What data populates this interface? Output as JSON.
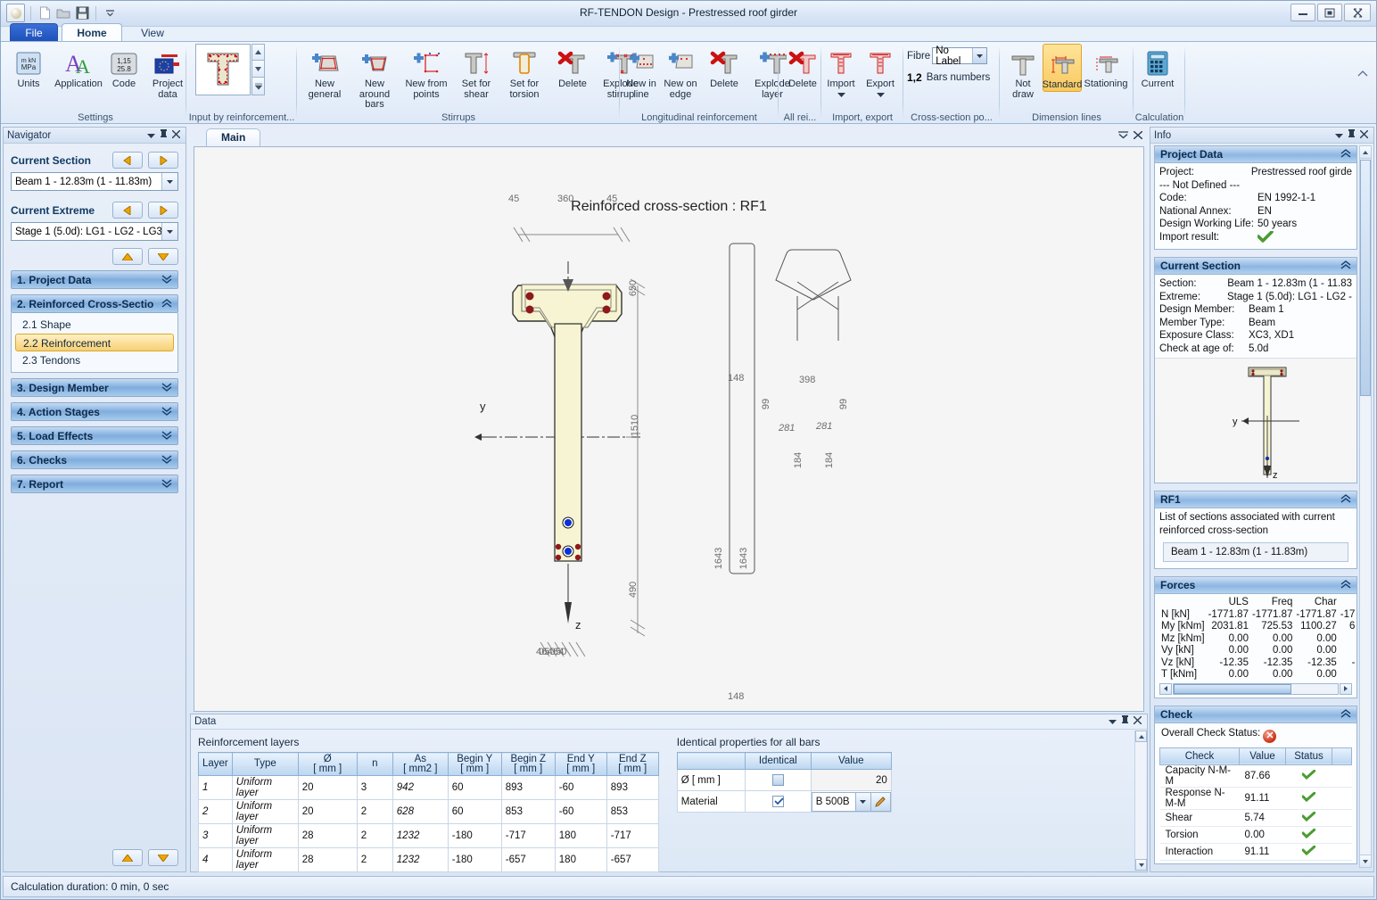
{
  "window": {
    "title": "RF-TENDON Design - Prestressed roof girder",
    "minimize": "–",
    "maximize": "□",
    "close": "✕"
  },
  "tabs": {
    "file": "File",
    "home": "Home",
    "view": "View"
  },
  "ribbon": {
    "groups": [
      {
        "title": "Settings",
        "buttons": [
          {
            "label": "Units",
            "icon": "units-icon"
          },
          {
            "label": "Application",
            "icon": "application-icon"
          },
          {
            "label": "Code",
            "icon": "code-icon"
          },
          {
            "label": "Project\ndata",
            "icon": "project-data-icon"
          }
        ]
      },
      {
        "title": "Input by reinforcement...",
        "gallery": "cross-section-gallery"
      },
      {
        "title": "Stirrups",
        "buttons": [
          {
            "label": "New\ngeneral",
            "icon": "new-general-icon"
          },
          {
            "label": "New around\nbars",
            "icon": "new-around-bars-icon"
          },
          {
            "label": "New from\npoints",
            "icon": "new-from-points-icon"
          },
          {
            "label": "Set for\nshear",
            "icon": "set-for-shear-icon"
          },
          {
            "label": "Set for\ntorsion",
            "icon": "set-for-torsion-icon"
          },
          {
            "label": "Delete",
            "icon": "delete-stirrup-icon"
          },
          {
            "label": "Explode\nstirrup",
            "icon": "explode-stirrup-icon"
          }
        ]
      },
      {
        "title": "Longitudinal reinforcement",
        "buttons": [
          {
            "label": "New in\nline",
            "icon": "new-in-line-icon"
          },
          {
            "label": "New on\nedge",
            "icon": "new-on-edge-icon"
          },
          {
            "label": "Delete",
            "icon": "delete-longitudinal-icon"
          },
          {
            "label": "Explode\nlayer",
            "icon": "explode-layer-icon"
          }
        ]
      },
      {
        "title": "All rei...",
        "buttons": [
          {
            "label": "Delete",
            "icon": "delete-all-icon"
          }
        ]
      },
      {
        "title": "Import, export",
        "buttons": [
          {
            "label": "Import",
            "icon": "import-icon",
            "dropdown": true
          },
          {
            "label": "Export",
            "icon": "export-icon",
            "dropdown": true
          }
        ]
      },
      {
        "title": "Cross-section po...",
        "fibre_label": "Fibre",
        "fibre_value": "No Label",
        "bars_numbers_prefix": "1,2",
        "bars_numbers_label": "Bars numbers"
      },
      {
        "title": "Dimension lines",
        "buttons": [
          {
            "label": "Not\ndraw",
            "icon": "not-draw-icon"
          },
          {
            "label": "Standard",
            "icon": "standard-dim-icon",
            "selected": true
          },
          {
            "label": "Stationing",
            "icon": "stationing-icon"
          }
        ]
      },
      {
        "title": "Calculation",
        "buttons": [
          {
            "label": "Current",
            "icon": "calculator-icon"
          }
        ]
      }
    ]
  },
  "navigator": {
    "panel_title": "Navigator",
    "current_section_label": "Current Section",
    "current_section_value": "Beam 1 - 12.83m (1 - 11.83m)",
    "current_extreme_label": "Current Extreme",
    "current_extreme_value": "Stage 1 (5.0d): LG1 - LG2 - LG3",
    "sections": [
      {
        "label": "1. Project Data",
        "expanded": false
      },
      {
        "label": "2. Reinforced Cross-Sectio",
        "expanded": true,
        "items": [
          {
            "label": "2.1 Shape",
            "active": false
          },
          {
            "label": "2.2 Reinforcement",
            "active": true
          },
          {
            "label": "2.3 Tendons",
            "active": false
          }
        ]
      },
      {
        "label": "3. Design Member",
        "expanded": false
      },
      {
        "label": "4. Action Stages",
        "expanded": false
      },
      {
        "label": "5. Load Effects",
        "expanded": false
      },
      {
        "label": "6. Checks",
        "expanded": false
      },
      {
        "label": "7. Report",
        "expanded": false
      }
    ]
  },
  "main": {
    "tab": "Main",
    "drawing_title": "Reinforced cross-section : RF1",
    "axis_y": "y",
    "axis_z": "z",
    "dimensions": {
      "top_left": "45",
      "top_mid": "360",
      "top_right": "45",
      "flange_height": "650",
      "web_height": "1510",
      "bottom_height": "490",
      "bottom_chain": "40 65 40 65 40"
    },
    "stirrup1": {
      "top": "148",
      "mid": "1643",
      "mid2": "1643",
      "bottom": "148"
    },
    "stirrup2": {
      "top": "398",
      "left_leg": "99",
      "right_leg": "99",
      "diag_left": "281",
      "diag_right": "281",
      "leg_left": "184",
      "leg_right": "184"
    }
  },
  "data_panel": {
    "panel_title": "Data",
    "table_label": "Reinforcement layers",
    "columns": [
      {
        "name": "Layer",
        "unit": ""
      },
      {
        "name": "Type",
        "unit": ""
      },
      {
        "name": "Ø",
        "unit": "[ mm ]"
      },
      {
        "name": "n",
        "unit": ""
      },
      {
        "name": "As",
        "unit": "[ mm2 ]"
      },
      {
        "name": "Begin Y",
        "unit": "[ mm ]"
      },
      {
        "name": "Begin Z",
        "unit": "[ mm ]"
      },
      {
        "name": "End Y",
        "unit": "[ mm ]"
      },
      {
        "name": "End Z",
        "unit": "[ mm ]"
      }
    ],
    "rows": [
      [
        "1",
        "Uniform layer",
        "20",
        "3",
        "942",
        "60",
        "893",
        "-60",
        "893"
      ],
      [
        "2",
        "Uniform layer",
        "20",
        "2",
        "628",
        "60",
        "853",
        "-60",
        "853"
      ],
      [
        "3",
        "Uniform layer",
        "28",
        "2",
        "1232",
        "-180",
        "-717",
        "180",
        "-717"
      ],
      [
        "4",
        "Uniform layer",
        "28",
        "2",
        "1232",
        "-180",
        "-657",
        "180",
        "-657"
      ]
    ],
    "identical_label": "Identical properties for all bars",
    "identical_columns": [
      "",
      "Identical",
      "Value"
    ],
    "identical_rows": [
      {
        "name": "Ø  [  mm  ]",
        "checked": false,
        "value": "20",
        "editor": "number"
      },
      {
        "name": "Material",
        "checked": true,
        "value": "B 500B",
        "editor": "combo"
      }
    ]
  },
  "info": {
    "panel_title": "Info",
    "project_data": {
      "title": "Project Data",
      "rows": [
        {
          "k": "Project:",
          "v": "Prestressed roof girde"
        },
        {
          "k": "--- Not Defined ---",
          "v": ""
        },
        {
          "k": "Code:",
          "v": "EN 1992-1-1"
        },
        {
          "k": "National Annex:",
          "v": "EN"
        },
        {
          "k": "Design Working Life:",
          "v": "50 years"
        },
        {
          "k": "Import result:",
          "v": ""
        }
      ]
    },
    "current_section": {
      "title": "Current Section",
      "rows": [
        {
          "k": "Section:",
          "v": "Beam 1 - 12.83m (1 - 11.83"
        },
        {
          "k": "Extreme:",
          "v": "Stage 1 (5.0d): LG1 - LG2 -"
        },
        {
          "k": "Design Member:",
          "v": "Beam 1"
        },
        {
          "k": "Member Type:",
          "v": "Beam"
        },
        {
          "k": "Exposure Class:",
          "v": "XC3, XD1"
        },
        {
          "k": "Check at age of:",
          "v": "5.0d"
        }
      ],
      "thumb_y": "y",
      "thumb_z": "z"
    },
    "rf1": {
      "title": "RF1",
      "description": "List of sections associated with current reinforced cross-section",
      "item": "Beam 1 - 12.83m (1 - 11.83m)"
    },
    "forces": {
      "title": "Forces",
      "columns": [
        "ULS",
        "Freq",
        "Char",
        ""
      ],
      "rows": [
        {
          "name": "N [kN]",
          "values": [
            "-1771.87",
            "-1771.87",
            "-1771.87",
            "-17"
          ]
        },
        {
          "name": "My [kNm]",
          "values": [
            "2031.81",
            "725.53",
            "1100.27",
            "6"
          ]
        },
        {
          "name": "Mz [kNm]",
          "values": [
            "0.00",
            "0.00",
            "0.00",
            ""
          ]
        },
        {
          "name": "Vy [kN]",
          "values": [
            "0.00",
            "0.00",
            "0.00",
            ""
          ]
        },
        {
          "name": "Vz [kN]",
          "values": [
            "-12.35",
            "-12.35",
            "-12.35",
            "-"
          ]
        },
        {
          "name": "T [kNm]",
          "values": [
            "0.00",
            "0.00",
            "0.00",
            ""
          ]
        }
      ]
    },
    "check": {
      "title": "Check",
      "overall_label": "Overall Check Status:",
      "overall_status": "fail",
      "columns": [
        "Check",
        "Value",
        "Status"
      ],
      "rows": [
        {
          "check": "Capacity N-M-M",
          "value": "87.66",
          "status": "ok"
        },
        {
          "check": "Response N-M-M",
          "value": "91.11",
          "status": "ok"
        },
        {
          "check": "Shear",
          "value": "5.74",
          "status": "ok"
        },
        {
          "check": "Torsion",
          "value": "0.00",
          "status": "ok"
        },
        {
          "check": "Interaction",
          "value": "91.11",
          "status": "ok"
        }
      ]
    }
  },
  "status": {
    "text": "Calculation duration: 0 min, 0 sec"
  },
  "colors": {
    "accent": "#f7cf72",
    "ok": "#3f9d2f",
    "fail": "#cc2f16",
    "concrete": "#f5f2cd",
    "rebar": "#8d1a1a",
    "tendon": "#0033cc"
  }
}
